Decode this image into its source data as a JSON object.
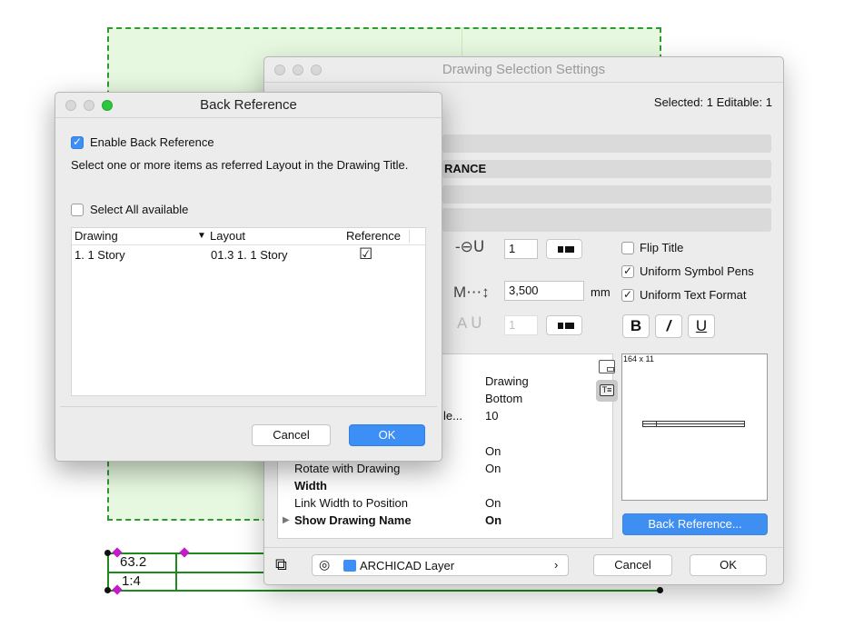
{
  "drawing": {
    "title_value": "63.2",
    "scale_value": "1:4"
  },
  "main_window": {
    "title": "Drawing Selection Settings",
    "selected_info": "Selected: 1 Editable: 1",
    "bar_text": "RANCE",
    "pen_value": "1",
    "size_value": "3,500",
    "size_unit": "mm",
    "text_pen_value": "1",
    "flip_title_label": "Flip Title",
    "uniform_symbol_pens_label": "Uniform Symbol Pens",
    "uniform_text_format_label": "Uniform Text Format",
    "bold_label": "B",
    "italic_label": "/",
    "underline_label": "U",
    "preview_size": "164 x 11",
    "properties": [
      {
        "key": "",
        "value": "Drawing"
      },
      {
        "key": "",
        "value": "Bottom"
      },
      {
        "key": "le...",
        "value": "10"
      },
      {
        "key": "",
        "value": "On"
      },
      {
        "key": "Rotate with Drawing",
        "value": "On"
      },
      {
        "key": "Width",
        "value": ""
      },
      {
        "key": "Link Width to Position",
        "value": "On"
      },
      {
        "key": "Show Drawing Name",
        "value": "On"
      }
    ],
    "back_reference_button": "Back Reference...",
    "layer_name": "ARCHICAD Layer",
    "cancel_label": "Cancel",
    "ok_label": "OK"
  },
  "back_reference_dialog": {
    "title": "Back Reference",
    "enable_label": "Enable Back Reference",
    "description": "Select one or more items as referred Layout in the Drawing Title.",
    "select_all_label": "Select All available",
    "columns": {
      "drawing": "Drawing",
      "layout": "Layout",
      "reference": "Reference"
    },
    "rows": [
      {
        "drawing": "1. 1 Story",
        "layout": "01.3 1. 1 Story",
        "reference": "☑"
      }
    ],
    "cancel_label": "Cancel",
    "ok_label": "OK"
  },
  "colors": {
    "accent": "#3d8ff5",
    "drawing_green": "#2f9a2f",
    "drawing_fill": "#e6f8df",
    "node_magenta": "#c21cc9"
  }
}
